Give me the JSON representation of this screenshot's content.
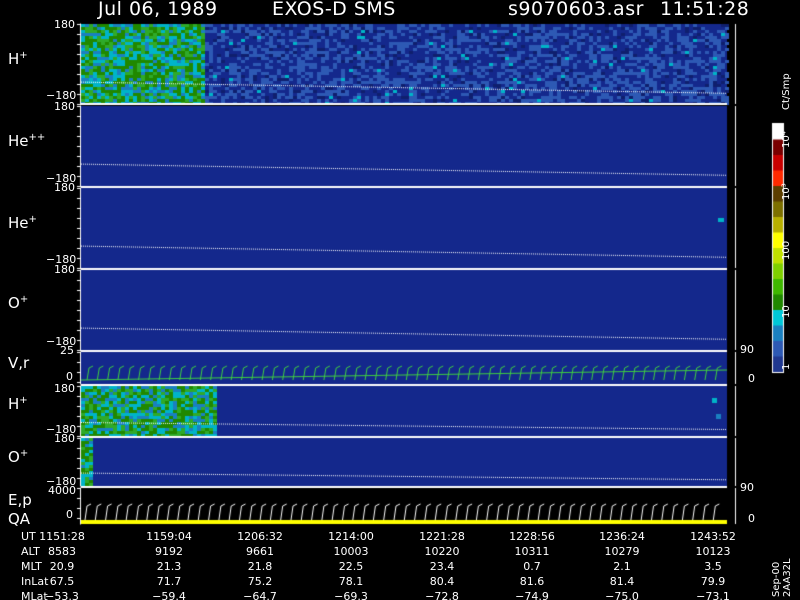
{
  "header": {
    "date": "Jul 06, 1989",
    "instrument": "EXOS-D SMS",
    "file": "s9070603.asr",
    "time": "11:51:28"
  },
  "colorbar": {
    "unit": "Ct/Smp",
    "labels": [
      "10⁴",
      "10³",
      "100",
      "10",
      "1"
    ],
    "colors": [
      "#ffffff",
      "#7a0000",
      "#c80000",
      "#ff2a00",
      "#5c3e00",
      "#7d7000",
      "#b8b000",
      "#ffff00",
      "#c0e000",
      "#7fd000",
      "#3fb800",
      "#208800",
      "#00c8d8",
      "#1a80c0",
      "#2d59b4",
      "#203890"
    ]
  },
  "side_labels": {
    "vr": "90",
    "vr_zero": "0",
    "o2": "90",
    "ep_zero": "0",
    "footer": "Sep-00 2AA32L"
  },
  "chart_data": [
    {
      "type": "heatmap",
      "panel": "H+ (spectrogram 1)",
      "label_base": "H",
      "label_sup": "+",
      "ylim": [
        -180,
        180
      ],
      "yticks": [
        "180",
        "−180"
      ],
      "activity": "high in first ~17% of interval, moderate thereafter"
    },
    {
      "type": "heatmap",
      "panel": "He++",
      "label_base": "He",
      "label_sup": "++",
      "ylim": [
        -180,
        180
      ],
      "yticks": [
        "180",
        "−180"
      ],
      "activity": "background only"
    },
    {
      "type": "heatmap",
      "panel": "He+",
      "label_base": "He",
      "label_sup": "+",
      "ylim": [
        -180,
        180
      ],
      "yticks": [
        "180",
        "−180"
      ],
      "activity": "background only"
    },
    {
      "type": "heatmap",
      "panel": "O+",
      "label_base": "O",
      "label_sup": "+",
      "ylim": [
        -180,
        180
      ],
      "yticks": [
        "180",
        "−180"
      ],
      "activity": "background only"
    },
    {
      "type": "line",
      "panel": "V,r",
      "label": "V,r",
      "ylim": [
        0,
        25
      ],
      "yticks": [
        "25",
        "0"
      ]
    },
    {
      "type": "heatmap",
      "panel": "H+ (spectrogram 2)",
      "label_base": "H",
      "label_sup": "+",
      "ylim": [
        -180,
        180
      ],
      "yticks": [
        "180",
        "−180"
      ],
      "activity": "high in first ~19% of interval"
    },
    {
      "type": "heatmap",
      "panel": "O+ (spectrogram 2)",
      "label_base": "O",
      "label_sup": "+",
      "ylim": [
        -180,
        180
      ],
      "yticks": [
        "180",
        "−180"
      ],
      "activity": "low at start"
    },
    {
      "type": "line",
      "panel": "E,p / QA",
      "label1": "E,p",
      "label2": "QA",
      "ylim": [
        0,
        4000
      ],
      "yticks": [
        "4000",
        "0"
      ]
    }
  ],
  "ephemeris": {
    "rows": [
      {
        "name": "UT",
        "values": [
          "1151:28",
          "1159:04",
          "1206:32",
          "1214:00",
          "1221:28",
          "1228:56",
          "1236:24",
          "1243:52"
        ]
      },
      {
        "name": "ALT",
        "values": [
          "8583",
          "9192",
          "9661",
          "10003",
          "10220",
          "10311",
          "10279",
          "10123"
        ]
      },
      {
        "name": "MLT",
        "values": [
          "20.9",
          "21.3",
          "21.8",
          "22.5",
          "23.4",
          "0.7",
          "2.1",
          "3.5"
        ]
      },
      {
        "name": "InLat",
        "values": [
          "67.5",
          "71.7",
          "75.2",
          "78.1",
          "80.4",
          "81.6",
          "81.4",
          "79.9"
        ]
      },
      {
        "name": "MLat",
        "values": [
          "−53.3",
          "−59.4",
          "−64.7",
          "−69.3",
          "−72.8",
          "−74.9",
          "−75.0",
          "−73.1"
        ]
      }
    ]
  }
}
